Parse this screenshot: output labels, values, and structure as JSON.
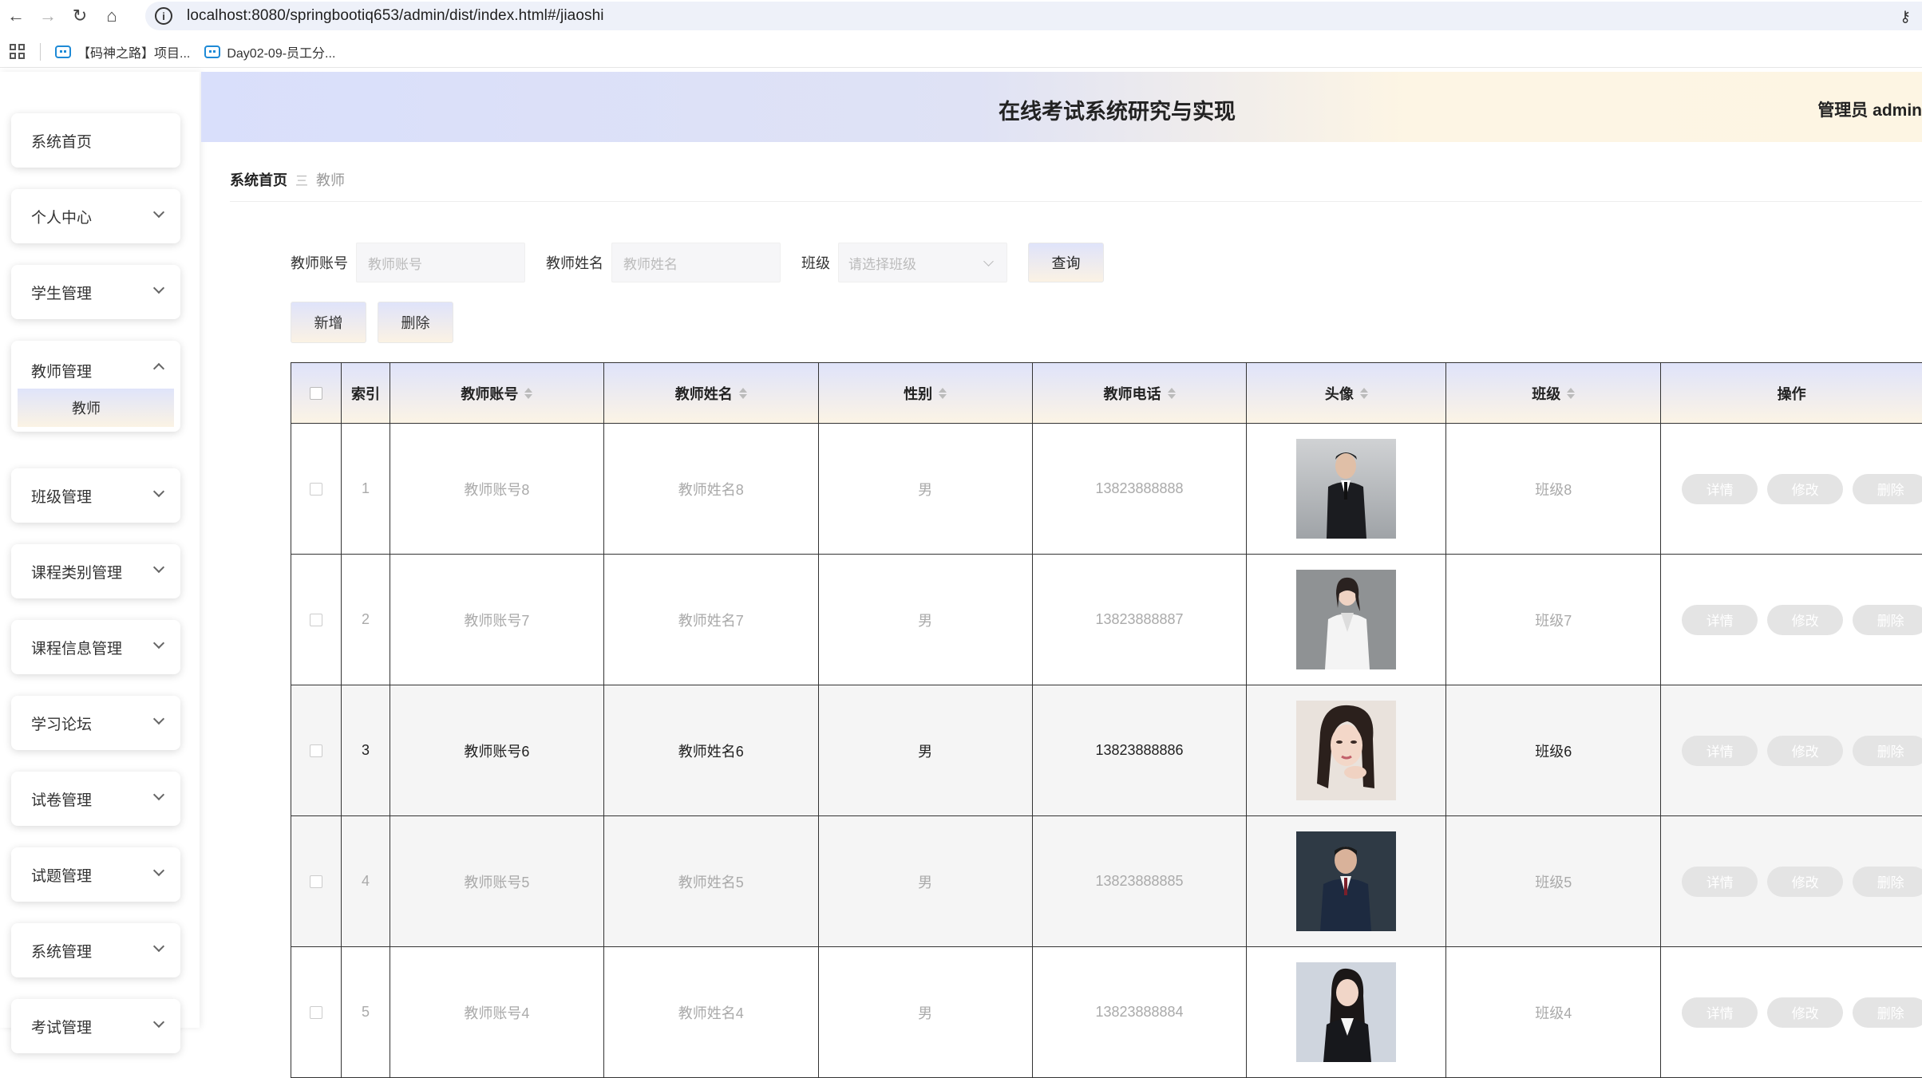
{
  "browser": {
    "url": "localhost:8080/springbootiq653/admin/dist/index.html#/jiaoshi",
    "bookmarks": [
      "【码神之路】项目...",
      "Day02-09-员工分..."
    ]
  },
  "sidebar": {
    "items": [
      {
        "label": "系统首页",
        "chevron": "none"
      },
      {
        "label": "个人中心",
        "chevron": "down"
      },
      {
        "label": "学生管理",
        "chevron": "down"
      },
      {
        "label": "教师管理",
        "chevron": "up",
        "sub": "教师"
      },
      {
        "label": "班级管理",
        "chevron": "down"
      },
      {
        "label": "课程类别管理",
        "chevron": "down"
      },
      {
        "label": "课程信息管理",
        "chevron": "down"
      },
      {
        "label": "学习论坛",
        "chevron": "down"
      },
      {
        "label": "试卷管理",
        "chevron": "down"
      },
      {
        "label": "试题管理",
        "chevron": "down"
      },
      {
        "label": "系统管理",
        "chevron": "down"
      },
      {
        "label": "考试管理",
        "chevron": "down"
      }
    ]
  },
  "header": {
    "title": "在线考试系统研究与实现",
    "user": "管理员 admin"
  },
  "breadcrumb": {
    "home": "系统首页",
    "separator": "三",
    "current": "教师"
  },
  "search": {
    "account_label": "教师账号",
    "account_placeholder": "教师账号",
    "name_label": "教师姓名",
    "name_placeholder": "教师姓名",
    "class_label": "班级",
    "class_placeholder": "请选择班级",
    "query_button": "查询"
  },
  "actions": {
    "add": "新增",
    "delete": "删除"
  },
  "table": {
    "columns": [
      "索引",
      "教师账号",
      "教师姓名",
      "性别",
      "教师电话",
      "头像",
      "班级",
      "操作"
    ],
    "rows": [
      {
        "index": "1",
        "account": "教师账号8",
        "name": "教师姓名8",
        "gender": "男",
        "phone": "13823888888",
        "class": "班级8",
        "avatar": "man-black-suit"
      },
      {
        "index": "2",
        "account": "教师账号7",
        "name": "教师姓名7",
        "gender": "男",
        "phone": "13823888887",
        "class": "班级7",
        "avatar": "woman-white-suit"
      },
      {
        "index": "3",
        "account": "教师账号6",
        "name": "教师姓名6",
        "gender": "男",
        "phone": "13823888886",
        "class": "班级6",
        "avatar": "woman-portrait"
      },
      {
        "index": "4",
        "account": "教师账号5",
        "name": "教师姓名5",
        "gender": "男",
        "phone": "13823888885",
        "class": "班级5",
        "avatar": "man-navy-suit"
      },
      {
        "index": "5",
        "account": "教师账号4",
        "name": "教师姓名4",
        "gender": "男",
        "phone": "13823888884",
        "class": "班级4",
        "avatar": "woman-dark-suit"
      }
    ],
    "op_labels": {
      "detail": "详情",
      "edit": "修改",
      "delete": "删除"
    }
  },
  "colors": {
    "header_gradient_start": "#d9dffb",
    "header_gradient_end": "#fdf5e4",
    "button_disabled": "#e4e4e4"
  }
}
